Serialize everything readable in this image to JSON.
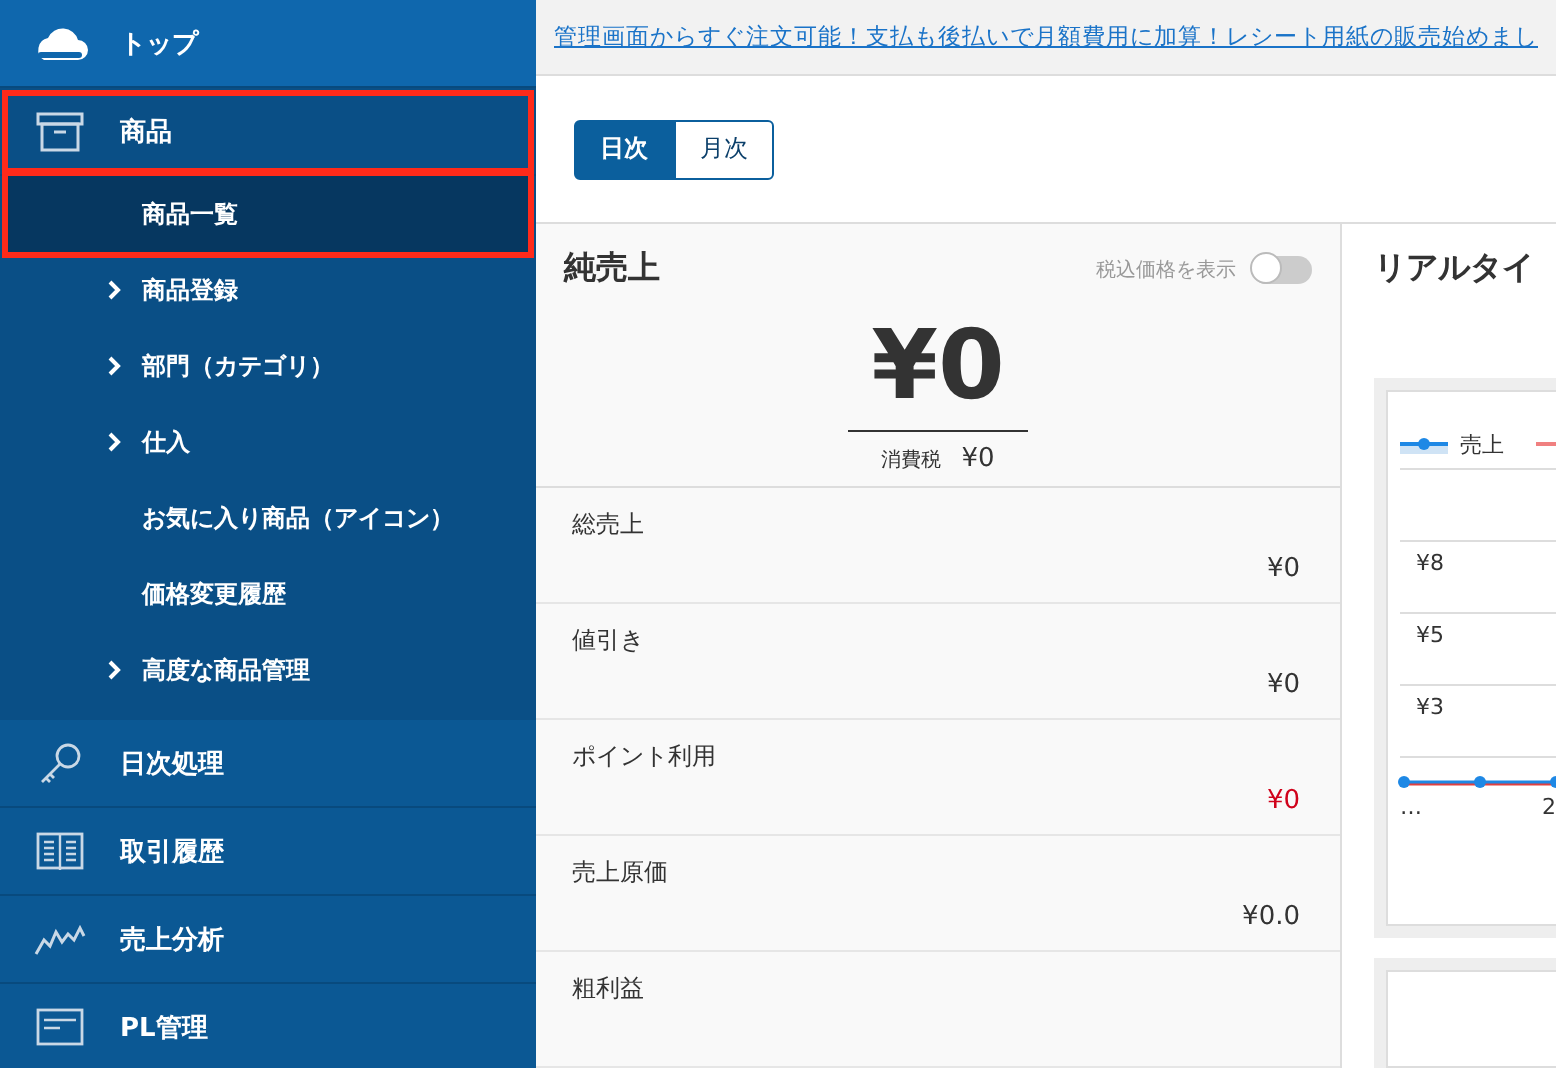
{
  "sidebar": {
    "items": [
      {
        "label": "トップ",
        "expanded": false,
        "highlighted": false
      },
      {
        "label": "商品",
        "expanded": true,
        "highlighted": true,
        "children": [
          {
            "label": "商品一覧",
            "expandable": false,
            "selected": true,
            "highlighted": true
          },
          {
            "label": "商品登録",
            "expandable": true,
            "selected": false,
            "highlighted": false
          },
          {
            "label": "部門（カテゴリ）",
            "expandable": true,
            "selected": false,
            "highlighted": false
          },
          {
            "label": "仕入",
            "expandable": true,
            "selected": false,
            "highlighted": false
          },
          {
            "label": "お気に入り商品（アイコン）",
            "expandable": false,
            "selected": false,
            "highlighted": false
          },
          {
            "label": "価格変更履歴",
            "expandable": false,
            "selected": false,
            "highlighted": false
          },
          {
            "label": "高度な商品管理",
            "expandable": true,
            "selected": false,
            "highlighted": false
          }
        ]
      },
      {
        "label": "日次処理",
        "expanded": false,
        "highlighted": false
      },
      {
        "label": "取引履歴",
        "expanded": false,
        "highlighted": false
      },
      {
        "label": "売上分析",
        "expanded": false,
        "highlighted": false
      },
      {
        "label": "PL管理",
        "expanded": false,
        "highlighted": false
      }
    ]
  },
  "banner": {
    "link": "管理画面からすぐ注文可能！支払も後払いで月額費用に加算！レシート用紙の販売始めまし"
  },
  "period_toggle": [
    {
      "label": "日次",
      "selected": true
    },
    {
      "label": "月次",
      "selected": false
    }
  ],
  "net_sales": {
    "title": "純売上",
    "tax_toggle": {
      "label": "税込価格を表示",
      "on": false
    },
    "amount": "¥0",
    "tax_label": "消費税",
    "tax_amount": "¥0",
    "rows": [
      {
        "label": "総売上",
        "value": "¥0",
        "negative": false
      },
      {
        "label": "値引き",
        "value": "¥0",
        "negative": false
      },
      {
        "label": "ポイント利用",
        "value": "¥0",
        "negative": true
      },
      {
        "label": "売上原価",
        "value": "¥0.0",
        "negative": false
      },
      {
        "label": "粗利益"
      }
    ]
  },
  "realtime": {
    "title": "リアルタイ",
    "legend": "売上",
    "y_labels": [
      "¥8",
      "¥5",
      "¥3"
    ],
    "x_labels": [
      "…",
      "2"
    ]
  }
}
